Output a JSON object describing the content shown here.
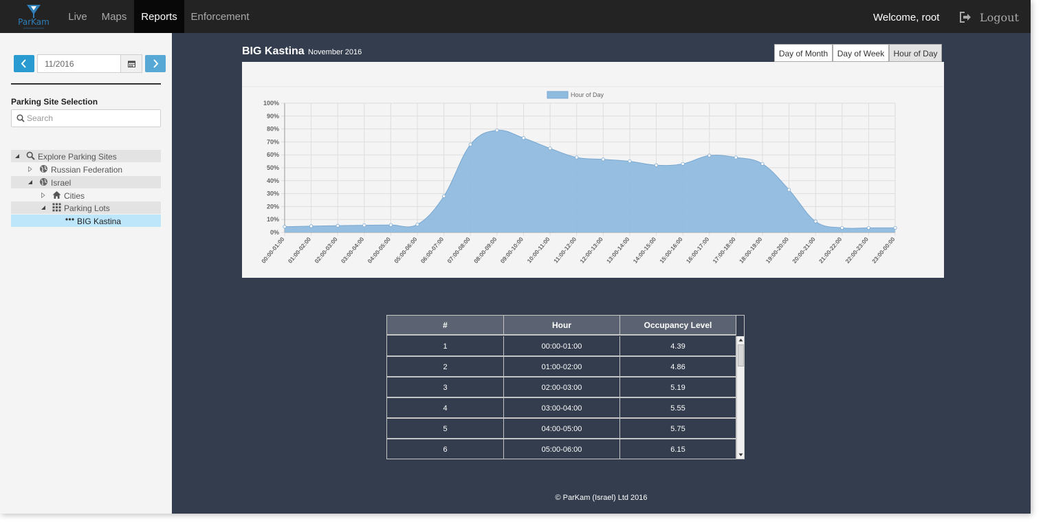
{
  "navbar": {
    "logo_text": "ParKam",
    "items": [
      {
        "label": "Live"
      },
      {
        "label": "Maps"
      },
      {
        "label": "Reports"
      },
      {
        "label": "Enforcement"
      }
    ],
    "active_item": "Reports",
    "welcome": "Welcome, root",
    "logout_label": "Logout",
    "colors": {
      "bar": "#232323",
      "active": "#080808"
    }
  },
  "sidebar": {
    "date_value": "11/2016",
    "section_title": "Parking Site Selection",
    "search_placeholder": "Search",
    "tree": [
      {
        "label": "Explore Parking Sites",
        "icon": "search-icon"
      },
      {
        "label": "Russian Federation",
        "icon": "globe-icon"
      },
      {
        "label": "Israel",
        "icon": "globe-icon"
      },
      {
        "label": "Cities",
        "icon": "home-icon"
      },
      {
        "label": "Parking Lots",
        "icon": "grid-icon"
      },
      {
        "label": "BIG Kastina",
        "icon": "dots-icon",
        "selected": true
      }
    ]
  },
  "report": {
    "title": "BIG Kastina",
    "subtitle": "November 2016",
    "view_buttons": [
      {
        "label": "Day of Month"
      },
      {
        "label": "Day of Week"
      },
      {
        "label": "Hour of Day"
      }
    ],
    "active_view": "Hour of Day"
  },
  "chart_data": {
    "type": "area",
    "series": [
      {
        "name": "Hour of Day",
        "values": [
          4.39,
          4.86,
          5.19,
          5.55,
          5.75,
          6.15,
          28,
          68,
          79,
          73,
          65,
          58,
          56.5,
          55,
          52,
          53,
          59.5,
          58,
          53,
          33,
          8.5,
          3.5,
          3.5,
          3.5
        ]
      }
    ],
    "categories": [
      "00:00-01:00",
      "01:00-02:00",
      "02:00-03:00",
      "03:00-04:00",
      "04:00-05:00",
      "05:00-06:00",
      "06:00-07:00",
      "07:00-08:00",
      "08:00-09:00",
      "09:00-10:00",
      "10:00-11:00",
      "11:00-12:00",
      "12:00-13:00",
      "13:00-14:00",
      "14:00-15:00",
      "15:00-16:00",
      "16:00-17:00",
      "17:00-18:00",
      "18:00-19:00",
      "19:00-20:00",
      "20:00-21:00",
      "21:00-22:00",
      "22:00-23:00",
      "23:00-00:00"
    ],
    "yticks": [
      "0%",
      "10%",
      "20%",
      "30%",
      "40%",
      "50%",
      "60%",
      "70%",
      "80%",
      "90%",
      "100%"
    ],
    "ylim": [
      0,
      100
    ],
    "grid": true,
    "legend": "top-center",
    "colors": {
      "fill": "#8fbbdf",
      "stroke": "#7aa8d0",
      "grid": "#dddddd"
    }
  },
  "table": {
    "headers": [
      "#",
      "Hour",
      "Occupancy Level"
    ],
    "rows": [
      [
        "1",
        "00:00-01:00",
        "4.39"
      ],
      [
        "2",
        "01:00-02:00",
        "4.86"
      ],
      [
        "3",
        "02:00-03:00",
        "5.19"
      ],
      [
        "4",
        "03:00-04:00",
        "5.55"
      ],
      [
        "5",
        "04:00-05:00",
        "5.75"
      ],
      [
        "6",
        "05:00-06:00",
        "6.15"
      ]
    ]
  },
  "footer": "© ParKam (Israel) Ltd 2016"
}
